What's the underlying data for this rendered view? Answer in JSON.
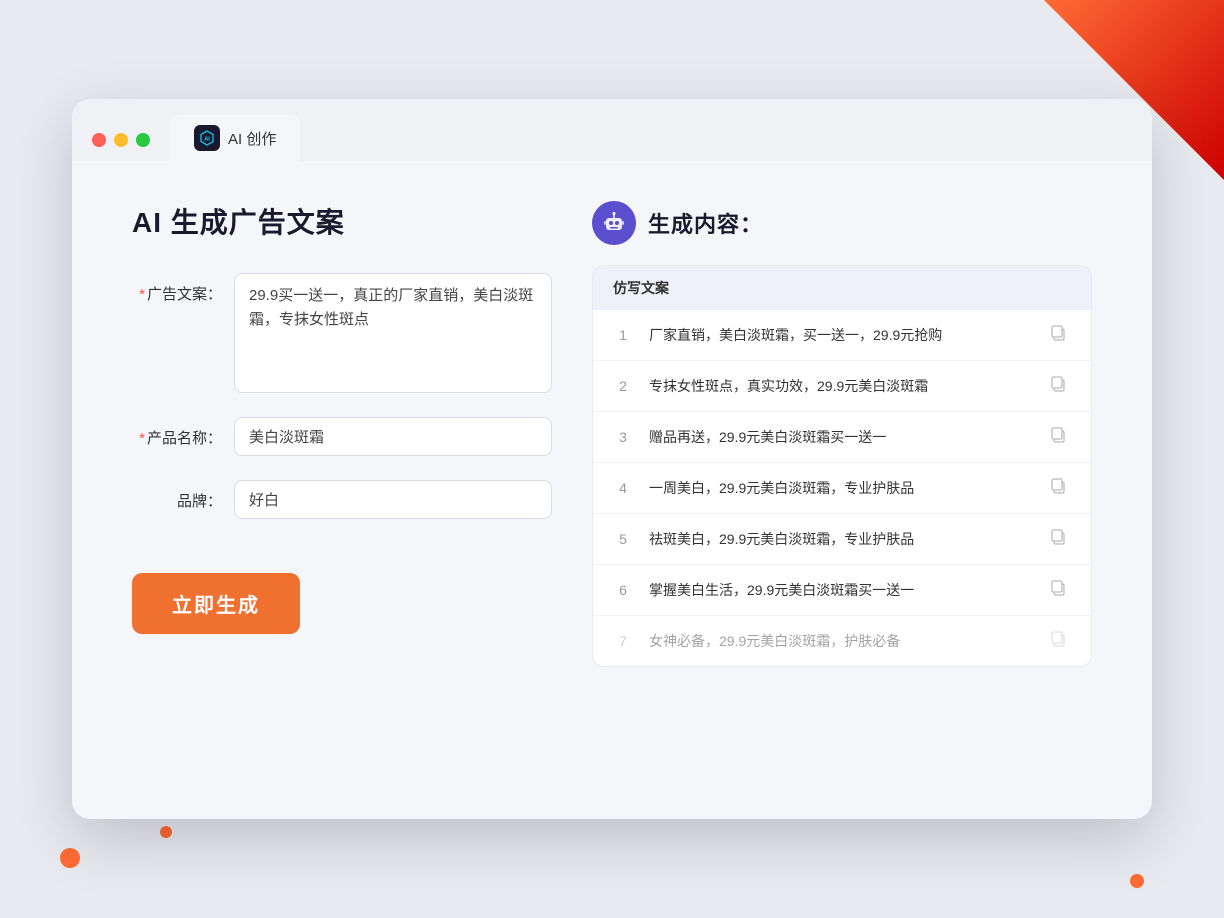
{
  "decorations": {},
  "browser": {
    "tab_label": "AI 创作",
    "controls": {
      "close": "close",
      "minimize": "minimize",
      "maximize": "maximize"
    }
  },
  "left_panel": {
    "title": "AI 生成广告文案",
    "form": {
      "ad_copy_label": "广告文案：",
      "ad_copy_required": "*",
      "ad_copy_value": "29.9买一送一，真正的厂家直销，美白淡斑霜，专抹女性斑点",
      "product_name_label": "产品名称：",
      "product_name_required": "*",
      "product_name_value": "美白淡斑霜",
      "brand_label": "品牌：",
      "brand_value": "好白",
      "generate_btn_label": "立即生成"
    }
  },
  "right_panel": {
    "title": "生成内容：",
    "table_header": "仿写文案",
    "results": [
      {
        "num": "1",
        "text": "厂家直销，美白淡斑霜，买一送一，29.9元抢购",
        "dimmed": false
      },
      {
        "num": "2",
        "text": "专抹女性斑点，真实功效，29.9元美白淡斑霜",
        "dimmed": false
      },
      {
        "num": "3",
        "text": "赠品再送，29.9元美白淡斑霜买一送一",
        "dimmed": false
      },
      {
        "num": "4",
        "text": "一周美白，29.9元美白淡斑霜，专业护肤品",
        "dimmed": false
      },
      {
        "num": "5",
        "text": "祛斑美白，29.9元美白淡斑霜，专业护肤品",
        "dimmed": false
      },
      {
        "num": "6",
        "text": "掌握美白生活，29.9元美白淡斑霜买一送一",
        "dimmed": false
      },
      {
        "num": "7",
        "text": "女神必备，29.9元美白淡斑霜，护肤必备",
        "dimmed": true
      }
    ]
  }
}
